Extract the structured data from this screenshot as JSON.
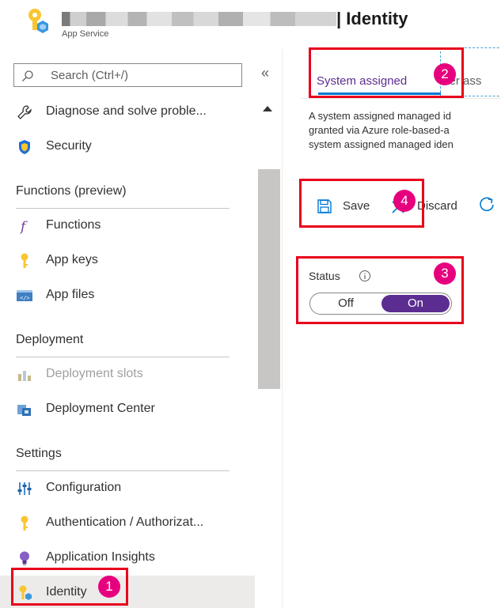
{
  "header": {
    "title": "| Identity",
    "subtitle": "App Service",
    "logo_icon": "app-service-key-icon"
  },
  "sidebar": {
    "search_placeholder": "Search (Ctrl+/)",
    "collapse_glyph": "«",
    "items": [
      {
        "label": "Diagnose and solve proble...",
        "icon": "wrench-icon"
      },
      {
        "label": "Security",
        "icon": "shield-icon"
      },
      {
        "label": "Functions",
        "icon": "function-icon"
      },
      {
        "label": "App keys",
        "icon": "key-icon"
      },
      {
        "label": "App files",
        "icon": "code-file-icon"
      },
      {
        "label": "Deployment slots",
        "icon": "slots-icon",
        "disabled": true
      },
      {
        "label": "Deployment Center",
        "icon": "deployment-center-icon"
      },
      {
        "label": "Configuration",
        "icon": "sliders-icon"
      },
      {
        "label": "Authentication / Authorizat...",
        "icon": "key-icon"
      },
      {
        "label": "Application Insights",
        "icon": "lightbulb-icon"
      },
      {
        "label": "Identity",
        "icon": "identity-icon",
        "active": true
      }
    ],
    "sections": {
      "functions": "Functions (preview)",
      "deployment": "Deployment",
      "settings": "Settings"
    }
  },
  "main": {
    "tabs": [
      {
        "label": "System assigned",
        "selected": true
      },
      {
        "label": "User assigned",
        "visible_text": "ser ass"
      }
    ],
    "description_lines": [
      "A system assigned managed id",
      "granted via Azure role-based-a",
      "system assigned managed iden"
    ],
    "toolbar": {
      "save_label": "Save",
      "discard_label": "Discard"
    },
    "status": {
      "label": "Status",
      "off_label": "Off",
      "on_label": "On",
      "value": "On"
    }
  },
  "callouts": [
    "1",
    "2",
    "3",
    "4"
  ],
  "colors": {
    "accent_purple": "#5c2d91",
    "tab_underline": "#0078d4",
    "callout_red": "#e8001c",
    "badge_pink": "#e6007e"
  }
}
